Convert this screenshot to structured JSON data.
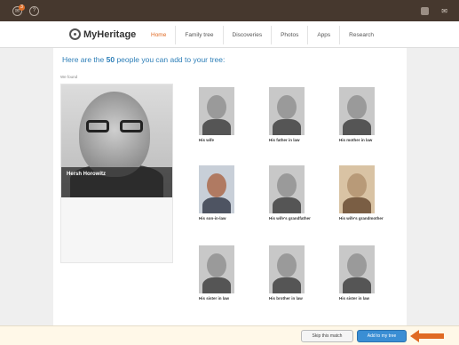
{
  "topbar": {
    "left_label": "",
    "notification_count": "3",
    "user_name": "",
    "language": ""
  },
  "nav": {
    "logo_text": "MyHeritage",
    "tabs": [
      {
        "label": "Home",
        "active": true
      },
      {
        "label": "Family tree",
        "active": false
      },
      {
        "label": "Discoveries",
        "active": false
      },
      {
        "label": "Photos",
        "active": false
      },
      {
        "label": "Apps",
        "active": false
      },
      {
        "label": "Research",
        "active": false
      }
    ]
  },
  "main": {
    "heading_prefix": "Here are the ",
    "heading_count": "50",
    "heading_suffix": " people you can add to your tree:",
    "left_column_label": "We found",
    "right_column_label": "",
    "found": {
      "name": "Hersh Horowitz",
      "subtitle": "",
      "details": []
    },
    "people": [
      {
        "relation": "His wife",
        "name": "",
        "photo_style": "bw"
      },
      {
        "relation": "His father in law",
        "name": "",
        "photo_style": "bw"
      },
      {
        "relation": "His mother in law",
        "name": "",
        "photo_style": "bw"
      },
      {
        "relation": "His son-in-law",
        "name": "",
        "photo_style": "color"
      },
      {
        "relation": "His wife's grandfather",
        "name": "",
        "photo_style": "bw"
      },
      {
        "relation": "His wife's grandmother",
        "name": "",
        "photo_style": "sepia"
      },
      {
        "relation": "His sister in law",
        "name": "",
        "photo_style": "bw"
      },
      {
        "relation": "His brother in law",
        "name": "",
        "photo_style": "bw"
      },
      {
        "relation": "His sister in law",
        "name": "",
        "photo_style": "bw"
      }
    ]
  },
  "bottom": {
    "text": "",
    "skip_label": "Skip this match",
    "add_label": "Add to my tree",
    "accent_color": "#e06a23",
    "button_color": "#3a8ed4"
  }
}
